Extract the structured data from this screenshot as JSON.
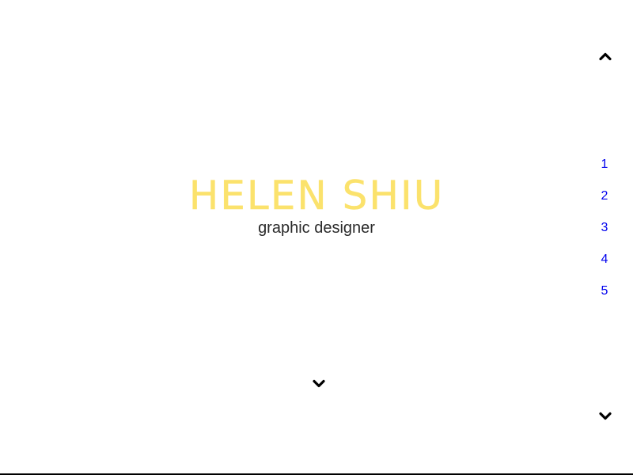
{
  "hero": {
    "name": "HELEN SHIU",
    "role": "graphic designer"
  },
  "navigation": {
    "up_icon": "chevron-up-icon",
    "down_icon": "chevron-down-icon",
    "pages": [
      "1",
      "2",
      "3",
      "4",
      "5"
    ]
  },
  "scroll_hint": {
    "icon": "chevron-down-icon"
  },
  "colors": {
    "title": "#fbe26c",
    "subtitle": "#2a2a2a",
    "links": "#0000ee",
    "icons": "#000000"
  }
}
